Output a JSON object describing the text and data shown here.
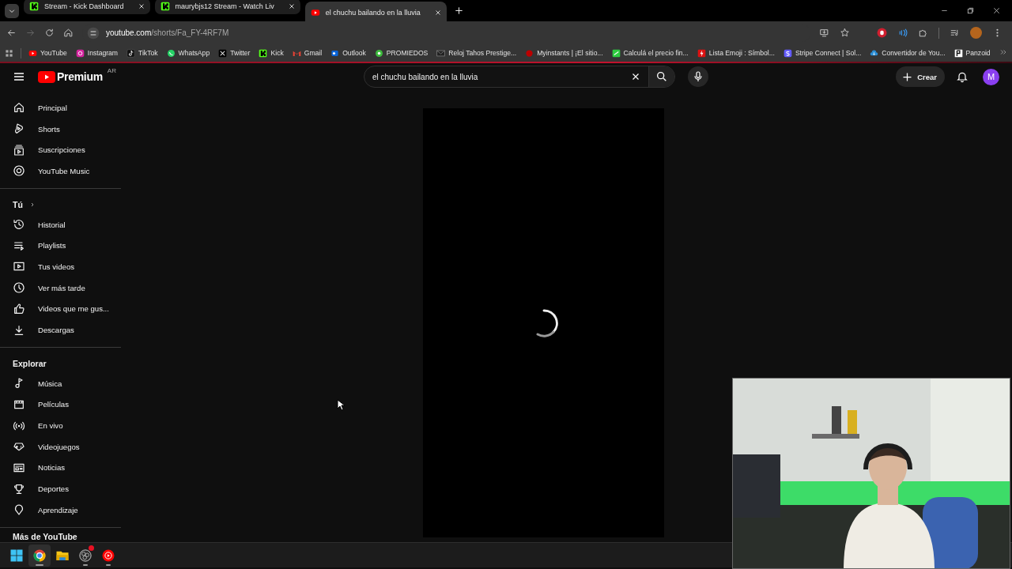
{
  "browser": {
    "tabs": [
      {
        "title": "Stream - Kick Dashboard",
        "selected": false
      },
      {
        "title": "maurybjs12 Stream - Watch Liv",
        "selected": false
      },
      {
        "title": "el chuchu bailando en la lluvia",
        "selected": true
      }
    ],
    "address": {
      "host": "youtube.com",
      "path": "/shorts/Fa_FY-4RF7M"
    },
    "bookmarks": [
      "YouTube",
      "Instagram",
      "TikTok",
      "WhatsApp",
      "Twitter",
      "Kick",
      "Gmail",
      "Outlook",
      "PROMIEDOS",
      "Reloj Tahos Prestige...",
      "Myinstants | ¡El sitio...",
      "Calculá el precio fin...",
      "Lista Emoji : Símbol...",
      "Stripe Connect | Sol...",
      "Convertidor de You...",
      "Panzoid"
    ]
  },
  "header": {
    "logo": "Premium",
    "region": "AR",
    "search": {
      "value": "el chuchu bailando en la lluvia"
    },
    "create": "Crear",
    "avatar": "M"
  },
  "sidebar": {
    "sections": [
      {
        "items": [
          "Principal",
          "Shorts",
          "Suscripciones",
          "YouTube Music"
        ]
      },
      {
        "kind": "link",
        "heading": "Tú",
        "items": [
          "Historial",
          "Playlists",
          "Tus videos",
          "Ver más tarde",
          "Videos que me gus...",
          "Descargas"
        ]
      },
      {
        "kind": "label",
        "heading": "Explorar",
        "items": [
          "Música",
          "Películas",
          "En vivo",
          "Videojuegos",
          "Noticias",
          "Deportes",
          "Aprendizaje"
        ]
      }
    ],
    "more_heading": "Más de YouTube"
  },
  "player": {
    "loading": true
  },
  "taskbar": {
    "apps": [
      {
        "selected": false,
        "running": false,
        "badge": false
      },
      {
        "selected": true,
        "running": true,
        "badge": false
      },
      {
        "selected": false,
        "running": false,
        "badge": false
      },
      {
        "selected": false,
        "running": true,
        "badge": true
      },
      {
        "selected": false,
        "running": true,
        "badge": false
      }
    ]
  }
}
